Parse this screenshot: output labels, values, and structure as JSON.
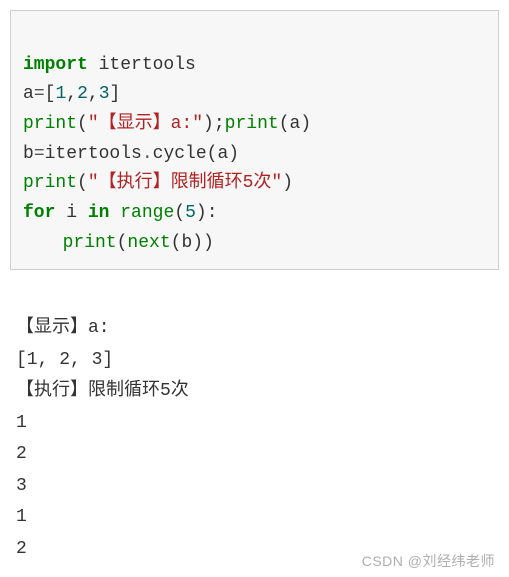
{
  "code": {
    "l1": {
      "kw1": "import",
      "mod": " itertools"
    },
    "l2": {
      "a": "a",
      "eq": "=",
      "lb": "[",
      "n1": "1",
      "c1": ",",
      "n2": "2",
      "c2": ",",
      "n3": "3",
      "rb": "]"
    },
    "l3": {
      "p1": "print",
      "lp1": "(",
      "s1": "\"【显示】a:\"",
      "rp1": ")",
      "semi": ";",
      "p2": "print",
      "lp2": "(",
      "arg": "a",
      "rp2": ")"
    },
    "l4": {
      "b": "b",
      "eq": "=",
      "mod": "itertools",
      "dot": ".",
      "fn": "cycle",
      "lp": "(",
      "arg": "a",
      "rp": ")"
    },
    "l5": {
      "p": "print",
      "lp": "(",
      "s": "\"【执行】限制循环5次\"",
      "rp": ")"
    },
    "l6": {
      "kw1": "for",
      "i": " i ",
      "kw2": "in",
      "sp": " ",
      "fn": "range",
      "lp": "(",
      "n": "5",
      "rp": ")",
      "colon": ":"
    },
    "l7": {
      "p": "print",
      "lp": "(",
      "fn": "next",
      "lp2": "(",
      "arg": "b",
      "rp2": ")",
      "rp": ")"
    }
  },
  "output": {
    "o1": "【显示】a:",
    "o2": "[1, 2, 3]",
    "o3": "【执行】限制循环5次",
    "o4": "1",
    "o5": "2",
    "o6": "3",
    "o7": "1",
    "o8": "2"
  },
  "watermark": "CSDN @刘经纬老师"
}
